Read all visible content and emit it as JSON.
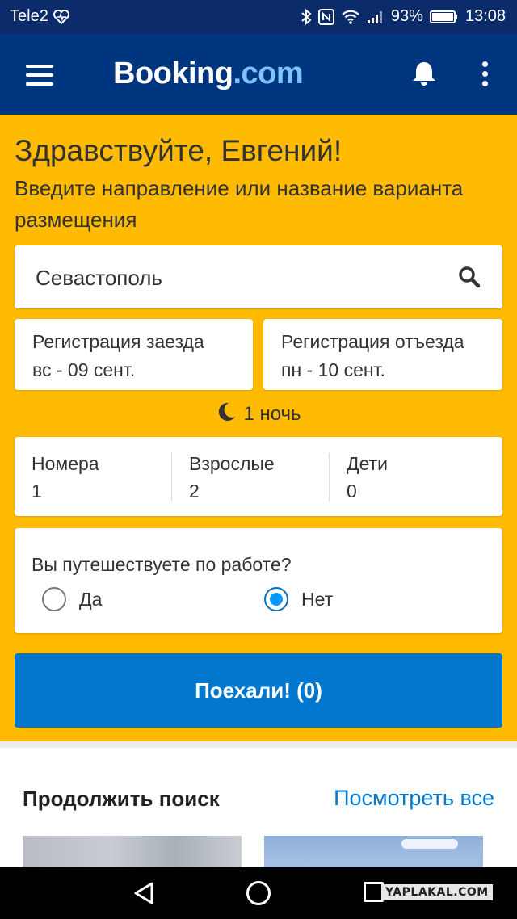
{
  "statusbar": {
    "carrier": "Tele2",
    "battery": "93%",
    "time": "13:08"
  },
  "appbar": {
    "logo_main": "Booking",
    "logo_suffix": ".com"
  },
  "hero": {
    "greeting": "Здравствуйте, Евгений!",
    "subtitle": "Введите направление или название варианта размещения",
    "search_value": "Севастополь",
    "checkin_label": "Регистрация заезда",
    "checkin_value": "вс - 09 сент.",
    "checkout_label": "Регистрация отъезда",
    "checkout_value": "пн - 10 сент.",
    "nights": "1 ночь",
    "rooms_label": "Номера",
    "rooms_value": "1",
    "adults_label": "Взрослые",
    "adults_value": "2",
    "children_label": "Дети",
    "children_value": "0",
    "work_question": "Вы путешествуете по работе?",
    "work_yes": "Да",
    "work_no": "Нет",
    "work_selected": "Нет",
    "search_button": "Поехали! (0)"
  },
  "recent": {
    "title": "Продолжить поиск",
    "see_all": "Посмотреть все"
  },
  "watermark": "YAPLAKAL.COM",
  "colors": {
    "brand_dark": "#003580",
    "hero_yellow": "#febb02",
    "button_blue": "#0077cc"
  }
}
